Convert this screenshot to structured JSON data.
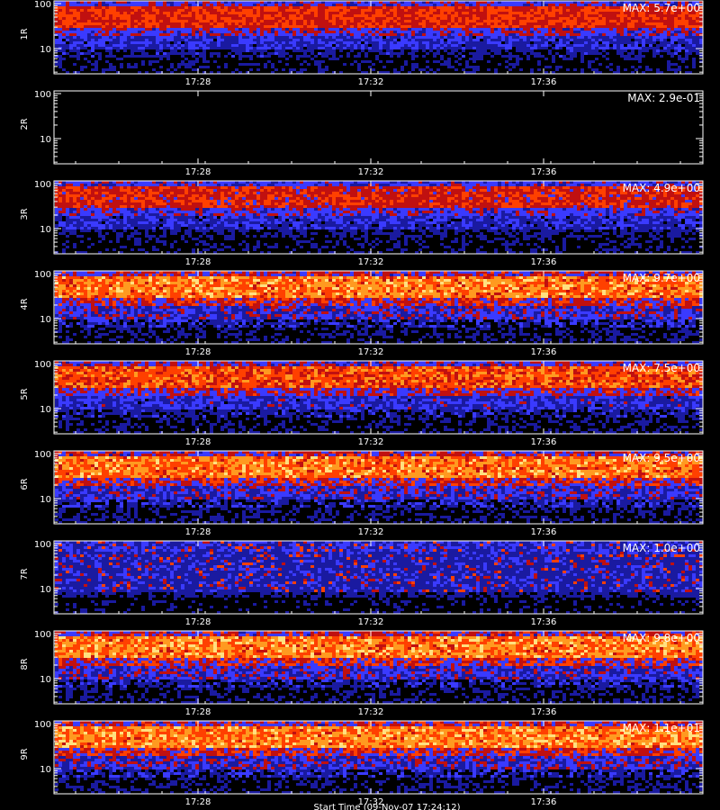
{
  "chart_data": {
    "type": "heatmap",
    "x_ticks": [
      "17:28",
      "17:32",
      "17:36"
    ],
    "y_ticks": [
      "10",
      "100"
    ],
    "y_scale": "log",
    "footer_label": "Start Time (09-Nov-07 17:24:12)",
    "colormap": [
      "#000000",
      "#1a1aa0",
      "#3a3aff",
      "#c01010",
      "#ff4000",
      "#ff9a20",
      "#ffe080"
    ],
    "panels": [
      {
        "label": "1R",
        "max_label": "MAX: 5.7e+00",
        "max": 5.7
      },
      {
        "label": "2R",
        "max_label": "MAX: 2.9e-01",
        "max": 0.29
      },
      {
        "label": "3R",
        "max_label": "MAX: 4.9e+00",
        "max": 4.9
      },
      {
        "label": "4R",
        "max_label": "MAX: 9.7e+00",
        "max": 9.7
      },
      {
        "label": "5R",
        "max_label": "MAX: 7.5e+00",
        "max": 7.5
      },
      {
        "label": "6R",
        "max_label": "MAX: 9.5e+00",
        "max": 9.5
      },
      {
        "label": "7R",
        "max_label": "MAX: 1.0e+00",
        "max": 1.0
      },
      {
        "label": "8R",
        "max_label": "MAX: 9.8e+00",
        "max": 9.8
      },
      {
        "label": "9R",
        "max_label": "MAX: 1.1e+01",
        "max": 11.0
      }
    ]
  }
}
